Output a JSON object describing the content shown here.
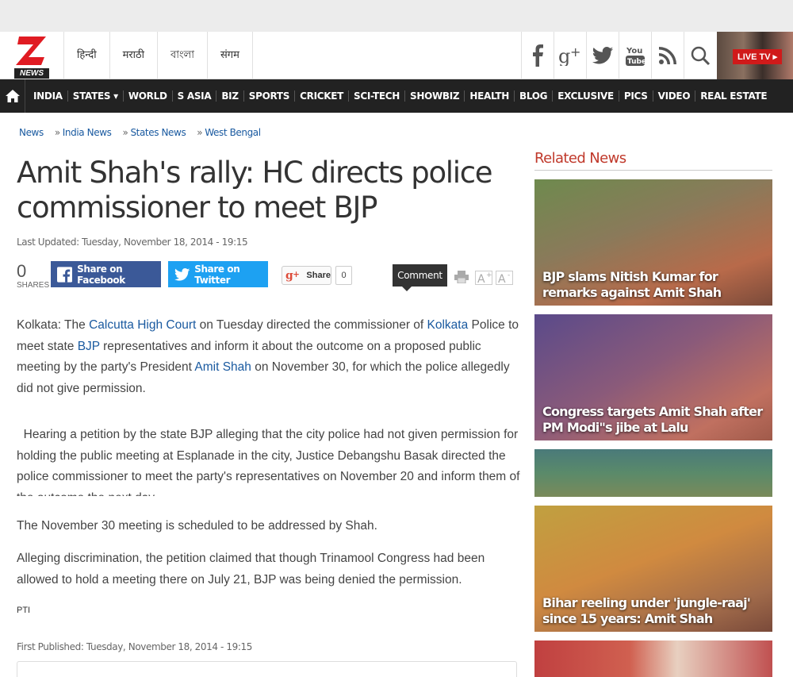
{
  "header": {
    "logo_text": "NEWS",
    "languages": [
      "हिन्दी",
      "मराठी",
      "বাংলা",
      "संगम"
    ],
    "social_icons": [
      "facebook-icon",
      "google-plus-icon",
      "twitter-icon",
      "youtube-icon",
      "rss-icon",
      "search-icon"
    ],
    "live_tv_label": "LIVE TV ▸"
  },
  "nav": {
    "items": [
      "INDIA",
      "STATES ▾",
      "WORLD",
      "S ASIA",
      "BIZ",
      "SPORTS",
      "CRICKET",
      "SCI-TECH",
      "SHOWBIZ",
      "HEALTH",
      "BLOG",
      "EXCLUSIVE",
      "PICS",
      "VIDEO",
      "REAL ESTATE"
    ]
  },
  "breadcrumb": [
    "News",
    "India News",
    "States News",
    "West Bengal"
  ],
  "article": {
    "title": "Amit Shah's rally: HC directs police commissioner to meet BJP",
    "last_updated": "Last Updated: Tuesday, November 18, 2014 - 19:15",
    "share_count": "0",
    "shares_label": "SHARES",
    "facebook_label": "Share on Facebook",
    "twitter_label": "Share on Twitter",
    "gplus_label": "Share",
    "gplus_count": "0",
    "comment_label": "Comment",
    "p1_parts": [
      "Kolkata: The ",
      "Calcutta High Court",
      " on Tuesday directed the commissioner of ",
      "Kolkata",
      " Police to meet state ",
      "BJP",
      " representatives and inform it about the outcome on a proposed public meeting by the party's President ",
      "Amit Shah",
      " on November 30, for which the police allegedly did not give permission."
    ],
    "p2": "  Hearing a petition by the state BJP alleging that the city police had not given permission for holding the public meeting at Esplanade in the city, Justice Debangshu Basak directed the police commissioner to meet the party's representatives on November 20 and inform them of the outcome the next day.",
    "p3": "The November 30 meeting is scheduled to be addressed by Shah.",
    "p4": "Alleging discrimination, the petition claimed that though Trinamool Congress had been allowed to hold a meeting there on July 21, BJP was being denied the permission.",
    "source": "PTI",
    "first_published": "First Published: Tuesday, November 18, 2014 - 19:15"
  },
  "related": {
    "title": "Related News",
    "items": [
      {
        "caption": "BJP slams Nitish Kumar for remarks against Amit Shah"
      },
      {
        "caption": "Congress targets Amit Shah after PM Modi\"s jibe at Lalu"
      },
      {
        "caption": ""
      },
      {
        "caption": "Bihar reeling under 'jungle-raaj' since 15 years: Amit Shah"
      },
      {
        "caption": ""
      }
    ]
  },
  "colors": {
    "accent_red": "#d01a1a",
    "nav_bg": "#222222",
    "link_blue": "#1a5aa0",
    "facebook": "#3b5998",
    "twitter": "#1da1f2",
    "related_title": "#c0392b"
  }
}
